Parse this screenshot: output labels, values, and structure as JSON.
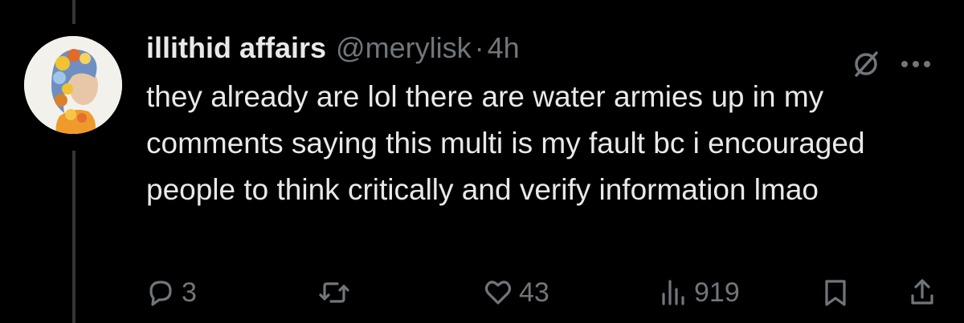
{
  "tweet": {
    "display_name": "illithid affairs",
    "handle": "@merylisk",
    "separator": "·",
    "time": "4h",
    "text": "they already are lol there are water armies up in my comments saying this multi is my fault bc i encouraged people to think critically and verify information lmao"
  },
  "actions": {
    "replies": "3",
    "retweets": "",
    "likes": "43",
    "views": "919"
  },
  "icons": {
    "avatar": "avatar-image",
    "grok": "grok-icon",
    "more": "more-icon",
    "reply": "reply-icon",
    "retweet": "retweet-icon",
    "like": "heart-icon",
    "views": "views-icon",
    "bookmark": "bookmark-icon",
    "share": "share-icon"
  },
  "colors": {
    "background": "#000000",
    "text": "#e7e9ea",
    "secondary": "#71767b",
    "thread_line": "#333639"
  }
}
